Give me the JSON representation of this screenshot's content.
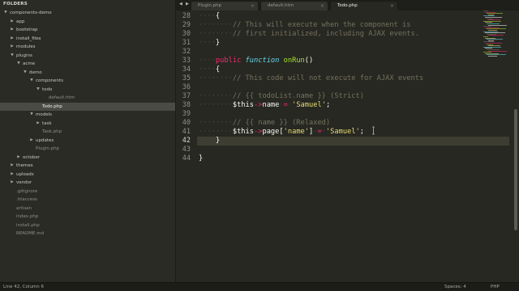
{
  "sidebar": {
    "header": "FOLDERS",
    "tree": [
      {
        "label": "components-demo",
        "type": "folder",
        "expanded": true,
        "depth": 0
      },
      {
        "label": "app",
        "type": "folder",
        "expanded": false,
        "depth": 1
      },
      {
        "label": "bootstrap",
        "type": "folder",
        "expanded": false,
        "depth": 1
      },
      {
        "label": "install_files",
        "type": "folder",
        "expanded": false,
        "depth": 1
      },
      {
        "label": "modules",
        "type": "folder",
        "expanded": false,
        "depth": 1
      },
      {
        "label": "plugins",
        "type": "folder",
        "expanded": true,
        "depth": 1
      },
      {
        "label": "acme",
        "type": "folder",
        "expanded": true,
        "depth": 2
      },
      {
        "label": "demo",
        "type": "folder",
        "expanded": true,
        "depth": 3
      },
      {
        "label": "components",
        "type": "folder",
        "expanded": true,
        "depth": 4
      },
      {
        "label": "todo",
        "type": "folder",
        "expanded": true,
        "depth": 5
      },
      {
        "label": "default.htm",
        "type": "file",
        "depth": 6
      },
      {
        "label": "Todo.php",
        "type": "file",
        "depth": 5,
        "selected": true
      },
      {
        "label": "models",
        "type": "folder",
        "expanded": true,
        "depth": 4
      },
      {
        "label": "task",
        "type": "folder",
        "expanded": false,
        "depth": 5
      },
      {
        "label": "Task.php",
        "type": "file",
        "depth": 5
      },
      {
        "label": "updates",
        "type": "folder",
        "expanded": false,
        "depth": 4
      },
      {
        "label": "Plugin.php",
        "type": "file",
        "depth": 4
      },
      {
        "label": "october",
        "type": "folder",
        "expanded": false,
        "depth": 2
      },
      {
        "label": "themes",
        "type": "folder",
        "expanded": false,
        "depth": 1
      },
      {
        "label": "uploads",
        "type": "folder",
        "expanded": false,
        "depth": 1
      },
      {
        "label": "vendor",
        "type": "folder",
        "expanded": false,
        "depth": 1
      },
      {
        "label": ".gitignore",
        "type": "file",
        "depth": 1
      },
      {
        "label": ".htaccess",
        "type": "file",
        "depth": 1
      },
      {
        "label": "artisan",
        "type": "file",
        "depth": 1
      },
      {
        "label": "index.php",
        "type": "file",
        "depth": 1
      },
      {
        "label": "install.php",
        "type": "file",
        "depth": 1
      },
      {
        "label": "README.md",
        "type": "file",
        "depth": 1
      }
    ]
  },
  "tabs": [
    {
      "label": "Plugin.php",
      "active": false
    },
    {
      "label": "default.htm",
      "active": false
    },
    {
      "label": "Todo.php",
      "active": true
    }
  ],
  "editor": {
    "current_line": 42,
    "lines": [
      {
        "n": 28,
        "tokens": [
          [
            "ws",
            "····"
          ],
          [
            "plain",
            "{"
          ]
        ]
      },
      {
        "n": 29,
        "tokens": [
          [
            "ws",
            "········"
          ],
          [
            "comment",
            "// This will execute when the component is"
          ]
        ]
      },
      {
        "n": 30,
        "tokens": [
          [
            "ws",
            "········"
          ],
          [
            "comment",
            "// first initialized, including AJAX events."
          ]
        ]
      },
      {
        "n": 31,
        "tokens": [
          [
            "ws",
            "····"
          ],
          [
            "plain",
            "}"
          ]
        ]
      },
      {
        "n": 32,
        "tokens": []
      },
      {
        "n": 33,
        "tokens": [
          [
            "ws",
            "····"
          ],
          [
            "keyword",
            "public"
          ],
          [
            "plain",
            " "
          ],
          [
            "storage",
            "function"
          ],
          [
            "plain",
            " "
          ],
          [
            "function",
            "onRun"
          ],
          [
            "plain",
            "()"
          ]
        ]
      },
      {
        "n": 34,
        "tokens": [
          [
            "ws",
            "····"
          ],
          [
            "plain",
            "{"
          ]
        ]
      },
      {
        "n": 35,
        "tokens": [
          [
            "ws",
            "········"
          ],
          [
            "comment",
            "// This code will not execute for AJAX events"
          ]
        ]
      },
      {
        "n": 36,
        "tokens": []
      },
      {
        "n": 37,
        "tokens": [
          [
            "ws",
            "········"
          ],
          [
            "comment",
            "// {{ todoList.name }} (Strict)"
          ]
        ]
      },
      {
        "n": 38,
        "tokens": [
          [
            "ws",
            "········"
          ],
          [
            "plain",
            "$this"
          ],
          [
            "operator",
            "->"
          ],
          [
            "plain",
            "name"
          ],
          [
            "ws",
            "·"
          ],
          [
            "operator",
            "="
          ],
          [
            "ws",
            "·"
          ],
          [
            "string",
            "'Samuel'"
          ],
          [
            "plain",
            ";"
          ]
        ]
      },
      {
        "n": 39,
        "tokens": []
      },
      {
        "n": 40,
        "tokens": [
          [
            "ws",
            "········"
          ],
          [
            "comment",
            "// {{ name }} (Relaxed)"
          ]
        ]
      },
      {
        "n": 41,
        "tokens": [
          [
            "ws",
            "········"
          ],
          [
            "plain",
            "$this"
          ],
          [
            "operator",
            "->"
          ],
          [
            "plain",
            "page["
          ],
          [
            "string",
            "'name'"
          ],
          [
            "plain",
            "]"
          ],
          [
            "ws",
            "·"
          ],
          [
            "operator",
            "="
          ],
          [
            "ws",
            "·"
          ],
          [
            "string",
            "'Samuel'"
          ],
          [
            "plain",
            ";"
          ]
        ]
      },
      {
        "n": 42,
        "tokens": [
          [
            "ws",
            "····"
          ],
          [
            "plain",
            "}"
          ]
        ]
      },
      {
        "n": 43,
        "tokens": []
      },
      {
        "n": 44,
        "tokens": [
          [
            "plain",
            "}"
          ]
        ]
      }
    ]
  },
  "minimap": {
    "colors": [
      "#75715e",
      "#f92672",
      "#a6e22e",
      "#e6db74",
      "#66d9ef",
      "#f8f8f2"
    ]
  },
  "status": {
    "position": "Line 42, Column 6",
    "indentation": "Spaces: 4",
    "syntax": "PHP"
  }
}
